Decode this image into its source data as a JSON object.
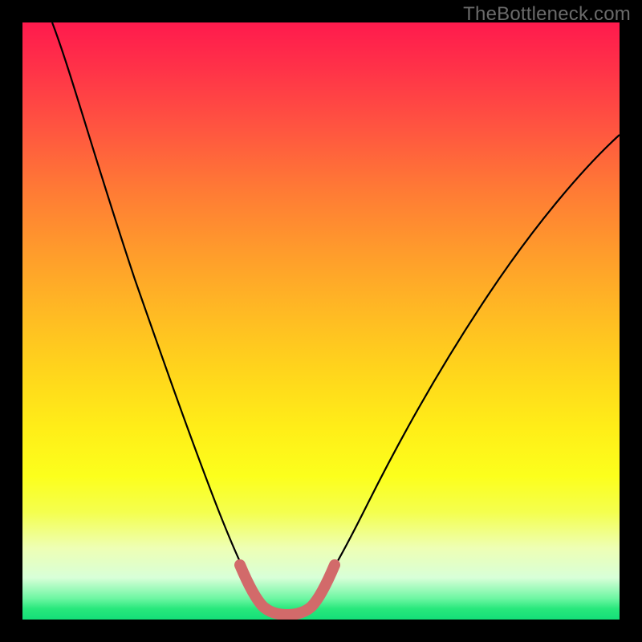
{
  "watermark": {
    "text": "TheBottleneck.com"
  },
  "chart_data": {
    "type": "line",
    "title": "",
    "xlabel": "",
    "ylabel": "",
    "xlim": [
      0,
      100
    ],
    "ylim": [
      0,
      100
    ],
    "grid": false,
    "legend": false,
    "series": [
      {
        "name": "bottleneck-curve",
        "color": "#000000",
        "x": [
          5,
          10,
          15,
          20,
          25,
          30,
          33,
          36,
          38,
          40,
          42,
          44,
          46,
          48,
          50,
          55,
          60,
          65,
          70,
          75,
          80,
          85,
          90,
          95,
          100
        ],
        "y": [
          100,
          88,
          76,
          65,
          53,
          40,
          30,
          20,
          12,
          6,
          3,
          2,
          2,
          3,
          6,
          13,
          22,
          30,
          38,
          45,
          52,
          58,
          64,
          69,
          74
        ]
      },
      {
        "name": "optimal-range-highlight",
        "color": "#d96b6b",
        "x": [
          36,
          38,
          40,
          42,
          44,
          46,
          48,
          50
        ],
        "y": [
          20,
          12,
          6,
          3,
          2,
          2,
          3,
          6
        ]
      }
    ],
    "background_gradient": {
      "top": "#ff1a4d",
      "mid": "#ffee18",
      "bottom": "#14df78"
    }
  }
}
